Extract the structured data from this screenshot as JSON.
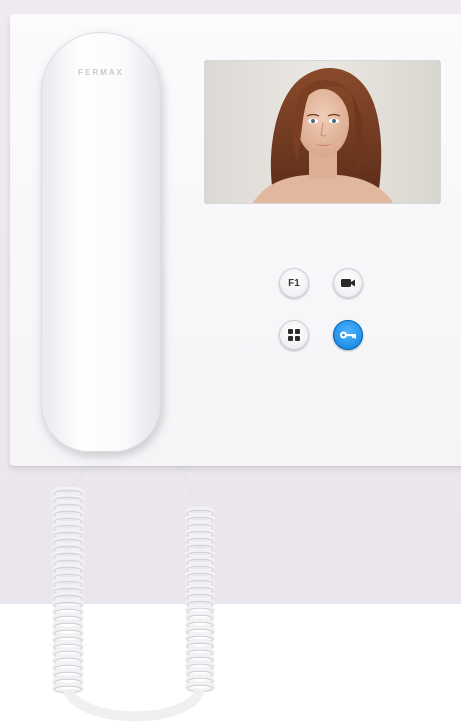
{
  "brand": {
    "logo_text": "FERMAX"
  },
  "monitor": {
    "screen": {
      "content": "woman-face-portrait"
    },
    "buttons": [
      {
        "id": "f1",
        "label": "F1",
        "icon": ""
      },
      {
        "id": "camera",
        "label": "",
        "icon": "video-camera-icon"
      },
      {
        "id": "menu",
        "label": "",
        "icon": "grid-icon"
      },
      {
        "id": "door",
        "label": "",
        "icon": "key-icon",
        "color": "#1d8de6"
      }
    ]
  },
  "colors": {
    "wall": "#ede7ef",
    "panel": "#f8f8fa",
    "accent_button": "#1d8de6"
  }
}
